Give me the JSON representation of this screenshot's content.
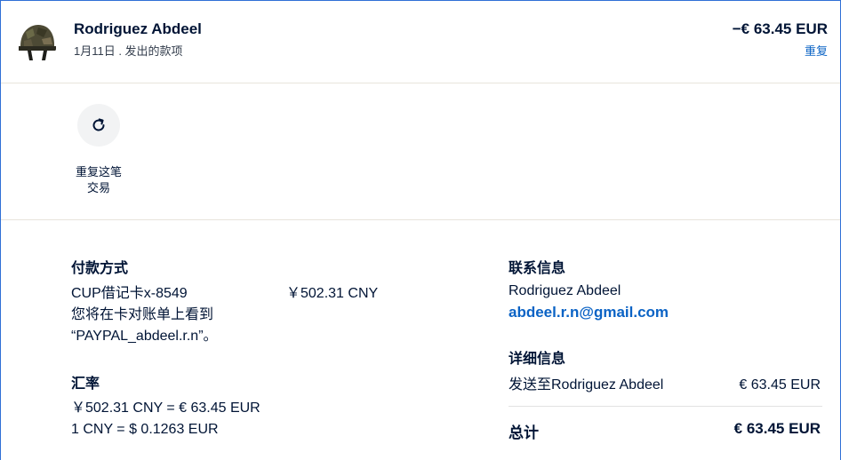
{
  "header": {
    "name": "Rodriguez Abdeel",
    "subtitle": "1月11日 . 发出的款项",
    "amount": "−€ 63.45 EUR",
    "repeat_link": "重复"
  },
  "action": {
    "label_line1": "重复这笔",
    "label_line2": "交易"
  },
  "payment_method": {
    "title": "付款方式",
    "card": "CUP借记卡x-8549",
    "card_amount": "￥502.31 CNY",
    "note_line1": "您将在卡对账单上看到",
    "note_line2": "“PAYPAL_abdeel.r.n”。"
  },
  "exchange_rate": {
    "title": "汇率",
    "line1": "￥502.31 CNY = € 63.45 EUR",
    "line2": "1 CNY = $ 0.1263 EUR"
  },
  "contact": {
    "title": "联系信息",
    "name": "Rodriguez Abdeel",
    "email": "abdeel.r.n@gmail.com"
  },
  "details": {
    "title": "详细信息",
    "sent_to_label": "发送至Rodriguez Abdeel",
    "sent_to_amount": "€ 63.45 EUR",
    "total_label": "总计",
    "total_value": "€ 63.45 EUR"
  },
  "colors": {
    "frame_border": "#2f6fd6",
    "link": "#0b63c5",
    "text": "#001435"
  }
}
